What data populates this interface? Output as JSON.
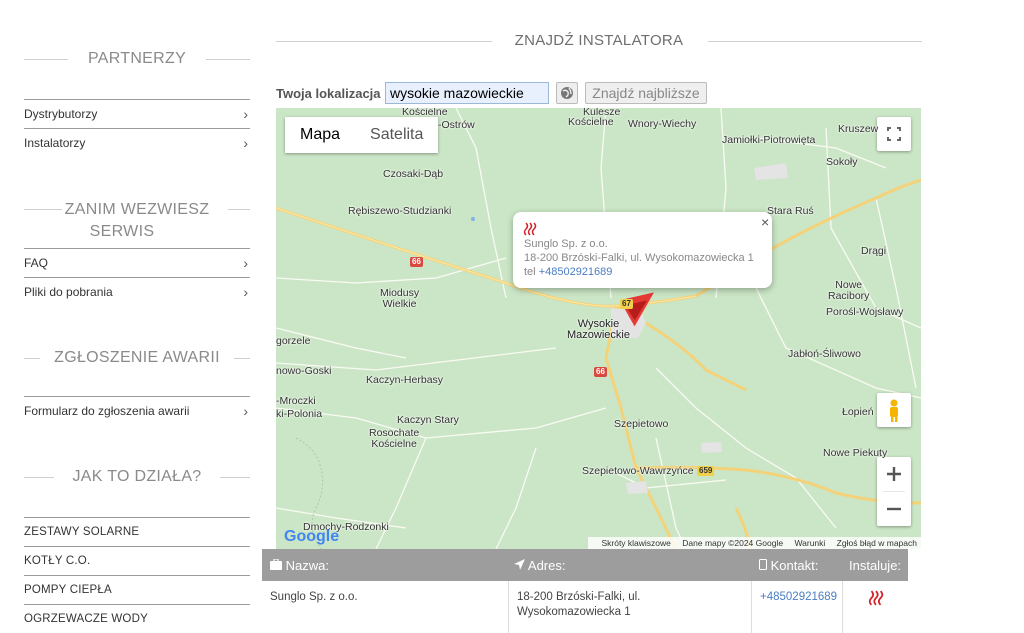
{
  "sidebar": {
    "sections": [
      {
        "title": "PARTNERZY",
        "items": [
          "Dystrybutorzy",
          "Instalatorzy"
        ]
      },
      {
        "title_line1": "ZANIM WEZWIESZ",
        "title_line2": "SERWIS",
        "items": [
          "FAQ",
          "Pliki do pobrania"
        ]
      },
      {
        "title": "ZGŁOSZENIE AWARII",
        "items": [
          "Formularz do zgłoszenia awarii"
        ]
      },
      {
        "title": "JAK TO DZIAŁA?",
        "items": [
          "ZESTAWY SOLARNE",
          "KOTŁY C.O.",
          "POMPY CIEPŁA",
          "OGRZEWACZE WODY"
        ]
      }
    ]
  },
  "main": {
    "title": "ZNAJDŹ INSTALATORA",
    "location_label": "Twoja lokalizacja",
    "location_value": "wysokie mazowieckie",
    "find_button": "Znajdź najbliższe"
  },
  "map": {
    "type_map": "Mapa",
    "type_satellite": "Satelita",
    "google_logo": "Google",
    "attribution": [
      "Skróty klawiszowe",
      "Dane mapy ©2024 Google",
      "Warunki",
      "Zgłoś błąd w mapach"
    ],
    "places": {
      "kulesze": "Kulesze",
      "koscielne_top": "Kościelne",
      "koscielne2": "Kościelne",
      "ostrow": "-Ostrów",
      "wnory": "Wnory-Wiechy",
      "jamiolki": "Jamiołki-Piotrowięta",
      "kruszew": "Kruszew",
      "sokoly": "Sokoły",
      "czosaki": "Czosaki-Dąb",
      "rebiszewo": "Rębiszewo-Studzianki",
      "stara_rus": "Stara Ruś",
      "dragi": "Drągi",
      "nowe_racibory": "Nowe\nRacibory",
      "porosl": "Porośl-Wojsławy",
      "miodusy": "Miodusy\nWielkie",
      "wysokie": "Wysokie\nMazowieckie",
      "gorzele": "gorzele",
      "jablon": "Jabłoń-Śliwowo",
      "nowo_goski": "nowo-Goski",
      "kaczyn_herbasy": "Kaczyn-Herbasy",
      "mroczki": "-Mroczki",
      "polonia": "ki-Polonia",
      "kaczyn_stary": "Kaczyn Stary",
      "rosochate": "Rosochate\nKościelne",
      "lopien": "Łopień",
      "szepietowo": "Szepietowo",
      "nowe_piekuty": "Nowe Piekuty",
      "wawrzynce": "Szepietowo-Wawrzyńce",
      "dmochy": "Dmochy-Rodzonki"
    },
    "roads": {
      "r66a": "66",
      "r66b": "66",
      "r659": "659",
      "r67": "67"
    },
    "info": {
      "name": "Sunglo Sp. z o.o.",
      "address": "18-200 Brzóski-Falki, ul. Wysokomazowiecka 1",
      "tel_prefix": "tel",
      "tel": "+48502921689"
    }
  },
  "table": {
    "headers": {
      "name": "Nazwa:",
      "address": "Adres:",
      "contact": "Kontakt:",
      "installs": "Instaluje:"
    },
    "rows": [
      {
        "name": "Sunglo Sp. z o.o.",
        "address": "18-200 Brzóski-Falki, ul. Wysokomazowiecka 1",
        "contact": "+48502921689"
      }
    ]
  },
  "colors": {
    "accent_red": "#d2232a",
    "link_blue": "#4a7ec3",
    "map_green": "#cbe6c6"
  }
}
